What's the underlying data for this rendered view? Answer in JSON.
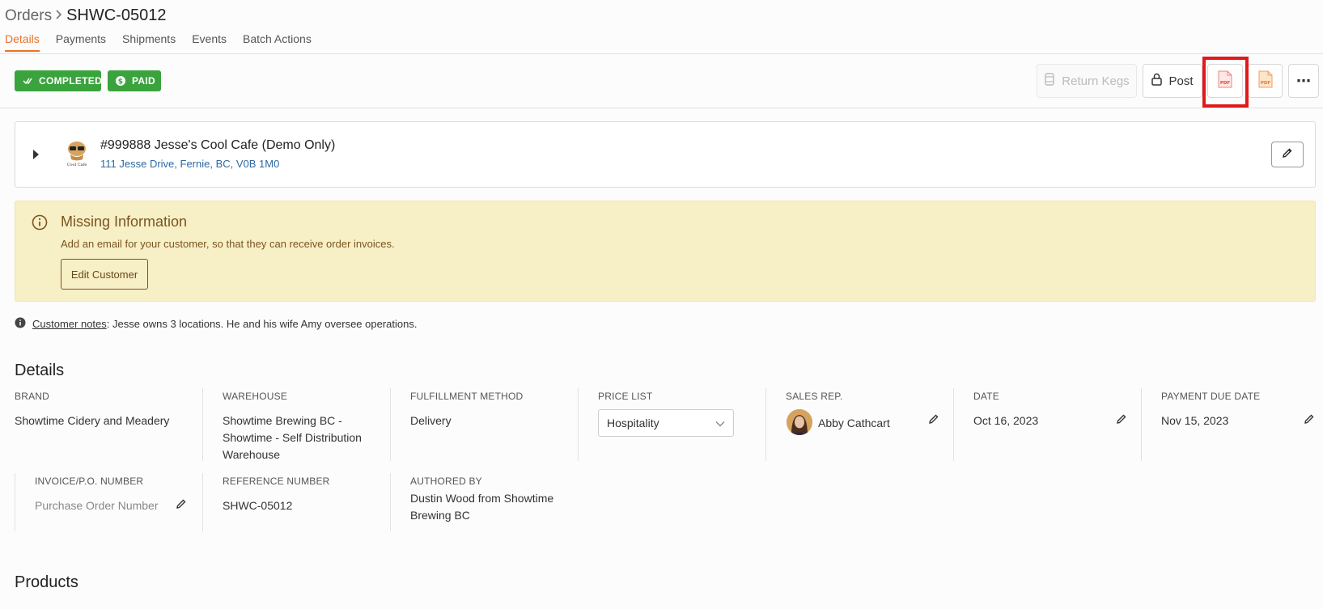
{
  "breadcrumb": {
    "root": "Orders",
    "separator": ">",
    "current": "SHWC-05012"
  },
  "tabs": [
    "Details",
    "Payments",
    "Shipments",
    "Events",
    "Batch Actions"
  ],
  "badges": {
    "completed": "COMPLETED",
    "paid": "PAID"
  },
  "actions": {
    "return_kegs": "Return Kegs",
    "post": "Post",
    "more": "⋯"
  },
  "customer": {
    "name": "#999888 Jesse's Cool Cafe (Demo Only)",
    "address": "111 Jesse Drive, Fernie, BC, V0B 1M0",
    "logo_text": "Cool Cafe"
  },
  "alert": {
    "title": "Missing Information",
    "message": "Add an email for your customer, so that they can receive order invoices.",
    "button": "Edit Customer"
  },
  "notes": {
    "link": "Customer notes",
    "text": ": Jesse owns 3 locations. He and his wife Amy oversee operations."
  },
  "details": {
    "title": "Details",
    "brand": {
      "label": "BRAND",
      "value": "Showtime Cidery and Meadery"
    },
    "warehouse": {
      "label": "WAREHOUSE",
      "value": "Showtime Brewing BC - Showtime - Self Distribution Warehouse"
    },
    "fulfillment": {
      "label": "FULFILLMENT METHOD",
      "value": "Delivery"
    },
    "price_list": {
      "label": "PRICE LIST",
      "value": "Hospitality"
    },
    "sales_rep": {
      "label": "SALES REP.",
      "value": "Abby Cathcart"
    },
    "date": {
      "label": "DATE",
      "value": "Oct 16, 2023"
    },
    "payment_due": {
      "label": "PAYMENT DUE DATE",
      "value": "Nov 15, 2023"
    },
    "invoice": {
      "label": "INVOICE/P.O. NUMBER",
      "placeholder": "Purchase Order Number"
    },
    "reference": {
      "label": "REFERENCE NUMBER",
      "value": "SHWC-05012"
    },
    "authored": {
      "label": "AUTHORED BY",
      "value": "Dustin Wood from Showtime Brewing BC"
    }
  },
  "products": {
    "title": "Products"
  },
  "colors": {
    "accent": "#e8732c",
    "success": "#3aa33d",
    "alert_bg": "#f7efc6",
    "alert_text": "#7a5520",
    "highlight": "#e01a1a"
  }
}
